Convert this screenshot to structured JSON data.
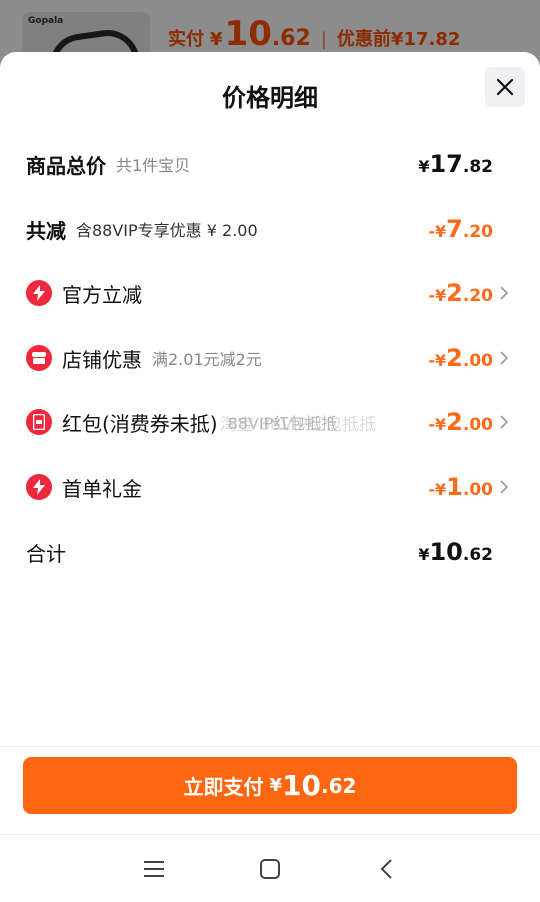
{
  "background": {
    "brand": "Gopala",
    "paid_label": "实付",
    "currency": "¥",
    "paid_int": "10",
    "paid_dec": ".62",
    "separator": "|",
    "before_label": "优惠前",
    "before_price": "¥17.82"
  },
  "sheet": {
    "title": "价格明细"
  },
  "rows": {
    "total": {
      "name": "商品总价",
      "sub": "共1件宝贝",
      "currency": "¥",
      "int": "17",
      "dec": ".82"
    },
    "reduce": {
      "name": "共减",
      "sub": "含88VIP专享优惠 ¥ 2.00",
      "currency": "-¥",
      "int": "7",
      "dec": ".20"
    },
    "official": {
      "name": "官方立减",
      "icon": "lightning-icon",
      "currency": "-¥",
      "int": "2",
      "dec": ".20"
    },
    "shop": {
      "name": "店铺优惠",
      "sub": "满2.01元减2元",
      "icon": "shop-icon",
      "currency": "-¥",
      "int": "2",
      "dec": ".00"
    },
    "redpacket": {
      "name": "红包(消费券未抵)",
      "sub": "88VIP红包抵抵",
      "icon": "red-packet-icon",
      "currency": "-¥",
      "int": "2",
      "dec": ".00"
    },
    "firstorder": {
      "name": "首单礼金",
      "icon": "lightning-icon",
      "currency": "-¥",
      "int": "1",
      "dec": ".00"
    },
    "sum": {
      "name": "合计",
      "currency": "¥",
      "int": "10",
      "dec": ".62"
    }
  },
  "watermark": "淘宝 88VIP红包抵抵",
  "pay_button": {
    "label": "立即支付",
    "currency": "¥",
    "int": "10",
    "dec": ".62"
  },
  "colors": {
    "accent": "#ff6610",
    "discount": "#ff6a1a",
    "icon_red": "#f0283c"
  }
}
